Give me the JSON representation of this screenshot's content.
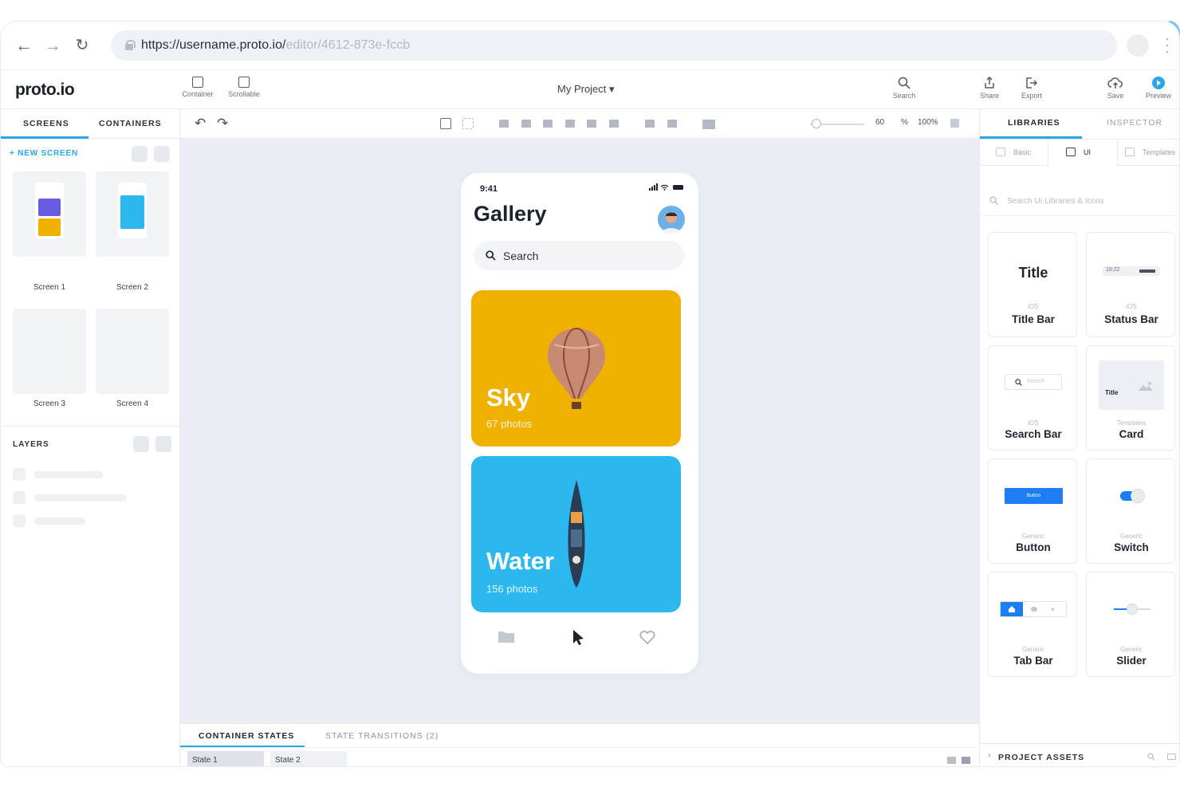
{
  "browser": {
    "url_main": "https://username.proto.io/",
    "url_dim": "editor/4612-873e-fccb"
  },
  "app": {
    "logo": "proto.io",
    "project_name": "My Project ▾",
    "tools_left": [
      "Container",
      "Scrollable"
    ],
    "tools_right": [
      "Search",
      "Share",
      "Export",
      "Save",
      "Preview"
    ]
  },
  "left": {
    "tab_screens": "SCREENS",
    "tab_containers": "CONTAINERS",
    "new_screen": "+ NEW SCREEN",
    "screens": [
      "Screen 1",
      "Screen 2",
      "Screen 3",
      "Screen 4"
    ],
    "layers": "LAYERS"
  },
  "toolbar": {
    "zoom_value": "60",
    "zoom_unit": "%",
    "zoom_fit": "100%"
  },
  "phone": {
    "time": "9:41",
    "title": "Gallery",
    "search": "Search",
    "cards": [
      {
        "title": "Sky",
        "sub": "67 photos",
        "color": "#f0b000"
      },
      {
        "title": "Water",
        "sub": "156 photos",
        "color": "#2cb8ef"
      }
    ]
  },
  "bottom": {
    "tab_states": "CONTAINER STATES",
    "tab_transitions": "STATE TRANSITIONS (2)",
    "states": [
      "State 1",
      "State 2"
    ]
  },
  "right": {
    "tab_libraries": "LIBRARIES",
    "tab_inspector": "INSPECTOR",
    "sub_basic": "Basic",
    "sub_ui": "UI",
    "sub_templates": "Templates",
    "search_placeholder": "Search UI Libraries & Icons",
    "cards": [
      {
        "kind": "iOS",
        "name": "Title Bar",
        "preview": "Title"
      },
      {
        "kind": "iOS",
        "name": "Status Bar",
        "preview": "16:22"
      },
      {
        "kind": "iOS",
        "name": "Search Bar",
        "preview": "Search"
      },
      {
        "kind": "Templates",
        "name": "Card",
        "preview": "Title"
      },
      {
        "kind": "Generic",
        "name": "Button",
        "preview": "Button"
      },
      {
        "kind": "Generic",
        "name": "Switch",
        "preview": ""
      },
      {
        "kind": "Generic",
        "name": "Tab Bar",
        "preview": ""
      },
      {
        "kind": "Generic",
        "name": "Slider",
        "preview": ""
      }
    ],
    "assets": "PROJECT ASSETS"
  },
  "colors": {
    "accent": "#2aa6e6",
    "canvas": "#eaeef4",
    "sky": "#f0b000",
    "water": "#2cb8ef"
  }
}
